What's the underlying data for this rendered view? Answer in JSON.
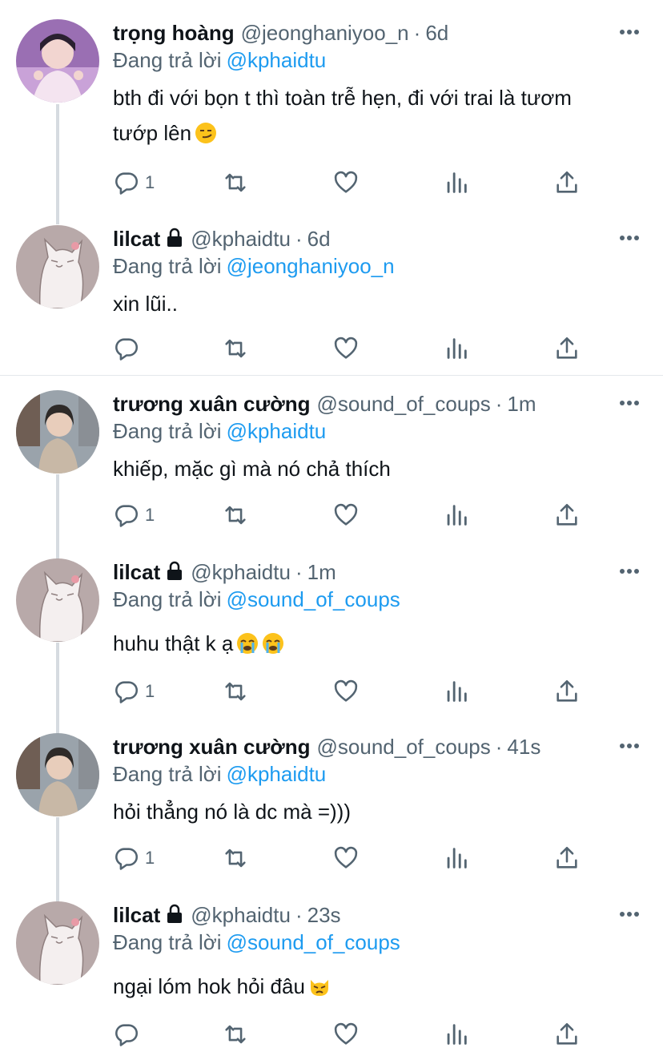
{
  "tweets": [
    {
      "name": "trọng hoàng",
      "handle": "@jeonghaniyoo_n",
      "dot": "·",
      "time": "6d",
      "replying_label": "Đang trả lời",
      "replying_to": "@kphaidtu",
      "text_line1": "bth đi với bọn t thì toàn trễ hẹn, đi với trai là tươm",
      "text_line2": "tướp lên",
      "emoji": "smirking-face",
      "reply_count": "1",
      "locked": false
    },
    {
      "name": "lilcat",
      "handle": "@kphaidtu",
      "dot": "·",
      "time": "6d",
      "replying_label": "Đang trả lời",
      "replying_to": "@jeonghaniyoo_n",
      "text_line1": "xin lũi..",
      "reply_count": "",
      "locked": true
    },
    {
      "name": "trương xuân cường",
      "handle": "@sound_of_coups",
      "dot": "·",
      "time": "1m",
      "replying_label": "Đang trả lời",
      "replying_to": "@kphaidtu",
      "text_line1": "khiếp, mặc gì mà nó chả thích",
      "reply_count": "1",
      "locked": false
    },
    {
      "name": "lilcat",
      "handle": "@kphaidtu",
      "dot": "·",
      "time": "1m",
      "replying_label": "Đang trả lời",
      "replying_to": "@sound_of_coups",
      "text_line1": "huhu thật k ạ",
      "emoji": "crying-face x2",
      "reply_count": "1",
      "locked": true
    },
    {
      "name": "trương xuân cường",
      "handle": "@sound_of_coups",
      "dot": "·",
      "time": "41s",
      "replying_label": "Đang trả lời",
      "replying_to": "@kphaidtu",
      "text_line1": "hỏi thẳng nó là dc mà =)))",
      "reply_count": "1",
      "locked": false
    },
    {
      "name": "lilcat",
      "handle": "@kphaidtu",
      "dot": "·",
      "time": "23s",
      "replying_label": "Đang trả lời",
      "replying_to": "@sound_of_coups",
      "text_line1": "ngại lóm hok hỏi đâu",
      "emoji": "pouting-cat",
      "reply_count": "",
      "locked": true
    }
  ],
  "colors": {
    "text": "#0f1419",
    "secondary": "#536471",
    "link": "#1d9bf0",
    "thread_line": "#d6dbe0",
    "icon": "#536471"
  },
  "icons": [
    "reply-icon",
    "retweet-icon",
    "like-icon",
    "views-icon",
    "share-icon",
    "more-icon",
    "lock-icon"
  ]
}
